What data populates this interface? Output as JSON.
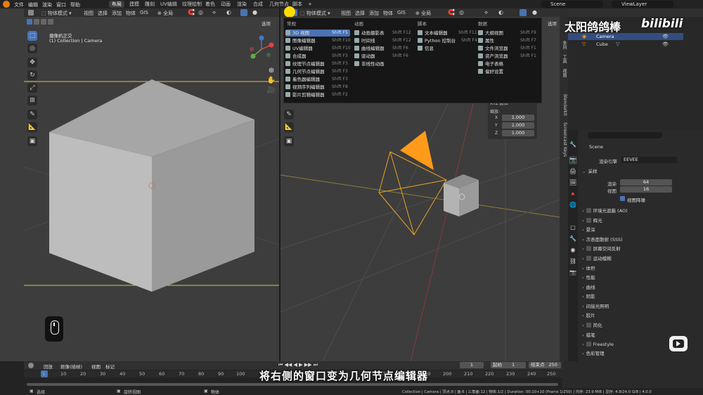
{
  "topbar": {
    "menus": [
      "文件",
      "编辑",
      "渲染",
      "窗口",
      "帮助"
    ],
    "workspace_tabs": [
      "布局",
      "建模",
      "雕刻",
      "UV编辑",
      "纹理绘制",
      "着色",
      "动画",
      "渲染",
      "合成",
      "几何节点",
      "脚本"
    ],
    "active_tab_index": 0,
    "add_tab": "+",
    "scene_name": "Scene",
    "view_layer": "ViewLayer"
  },
  "left_viewport": {
    "mode": "物体模式",
    "menus": [
      "视图",
      "选择",
      "添加",
      "物体",
      "GIS"
    ],
    "pivot": "全局",
    "options_label": "选项",
    "view_title": "摄像机正交",
    "view_subtitle": "(1) Collection | Camera"
  },
  "right_viewport": {
    "mode": "物体模式",
    "menus": [
      "视图",
      "选择",
      "添加",
      "物体",
      "GIS"
    ],
    "pivot": "全局",
    "options_label": "选项",
    "panel": {
      "title": "XYZ 欧拉",
      "scale_label": "缩放:",
      "rows": [
        {
          "axis": "X",
          "value": "1.000"
        },
        {
          "axis": "Y",
          "value": "1.000"
        },
        {
          "axis": "Z",
          "value": "1.000"
        }
      ]
    }
  },
  "editor_menu": {
    "columns": [
      {
        "title": "常规",
        "items": [
          {
            "label": "3D 视图",
            "shortcut": "Shift F5",
            "selected": true
          },
          {
            "label": "图像编辑器",
            "shortcut": "Shift F10"
          },
          {
            "label": "UV编辑器",
            "shortcut": "Shift F10"
          },
          {
            "label": "合成器",
            "shortcut": "Shift F3"
          },
          {
            "label": "纹理节点编辑器",
            "shortcut": "Shift F3"
          },
          {
            "label": "几何节点编辑器",
            "shortcut": "Shift F3"
          },
          {
            "label": "着色器编辑器",
            "shortcut": "Shift F3"
          },
          {
            "label": "视频序列编辑器",
            "shortcut": "Shift F8"
          },
          {
            "label": "影片剪辑编辑器",
            "shortcut": "Shift F2"
          }
        ]
      },
      {
        "title": "动画",
        "items": [
          {
            "label": "动画摄影表",
            "shortcut": "Shift F12"
          },
          {
            "label": "时间线",
            "shortcut": "Shift F12"
          },
          {
            "label": "曲线编辑器",
            "shortcut": "Shift F6"
          },
          {
            "label": "驱动器",
            "shortcut": "Shift F6"
          },
          {
            "label": "非线性动画",
            "shortcut": ""
          }
        ]
      },
      {
        "title": "脚本",
        "items": [
          {
            "label": "文本编辑器",
            "shortcut": "Shift F11"
          },
          {
            "label": "Python 控制台",
            "shortcut": "Shift F4"
          },
          {
            "label": "信息",
            "shortcut": ""
          }
        ]
      },
      {
        "title": "数据",
        "items": [
          {
            "label": "大纲视图",
            "shortcut": "Shift F9"
          },
          {
            "label": "属性",
            "shortcut": "Shift F7"
          },
          {
            "label": "文件浏览器",
            "shortcut": "Shift F1"
          },
          {
            "label": "资产浏览器",
            "shortcut": "Shift F1"
          },
          {
            "label": "电子表格",
            "shortcut": ""
          },
          {
            "label": "偏好设置",
            "shortcut": ""
          }
        ]
      }
    ]
  },
  "side_tabs": [
    "条目",
    "工具",
    "视图",
    "Blenderkit",
    "Screencast Keys"
  ],
  "outliner": {
    "items": [
      {
        "name": "Camera",
        "selected": true
      },
      {
        "name": "Cube",
        "selected": false
      }
    ]
  },
  "properties": {
    "scene_label": "Scene",
    "engine_label": "渲染引擎",
    "engine_value": "EEVEE",
    "sampling": {
      "title": "采样",
      "render_label": "渲染",
      "render_value": "64",
      "viewport_label": "视图",
      "viewport_value": "16",
      "denoise_label": "视图降噪"
    },
    "sections": [
      "环境光遮蔽 (AO)",
      "辉光",
      "景深",
      "次表面散射 (SSS)",
      "屏幕空间反射",
      "运动模糊",
      "体积",
      "性能",
      "曲线",
      "阴影",
      "间接光照明",
      "胶片",
      "简化",
      "蜡笔",
      "Freestyle",
      "色彩管理"
    ]
  },
  "timeline": {
    "menus": [
      "回放",
      "抠像(插帧)",
      "视图",
      "标记"
    ],
    "current_frame": "1",
    "start_label": "起始",
    "start_value": "1",
    "end_label": "结束点",
    "end_value": "250",
    "ticks": [
      "1",
      "10",
      "20",
      "30",
      "40",
      "50",
      "60",
      "70",
      "80",
      "90",
      "100",
      "170",
      "180",
      "190",
      "200",
      "210",
      "220",
      "230",
      "240",
      "250"
    ]
  },
  "status_bar": {
    "left": [
      "选择",
      "旋转视图",
      "物体"
    ],
    "right": "Collection | Camera | 顶点:8 | 面:6 | 三角面:12 | 物体:1/2 | Duration: 00:10+10 (Frame 1/250) | 内存: 23.9 MiB | 显存: 4.8/24.0 GiB | 4.0.0"
  },
  "subtitle": "将右侧的窗口变为几何节点编辑器",
  "watermark": {
    "channel": "太阳鸽鸽棒",
    "site": "bilibili"
  },
  "colors": {
    "accent_blue": "#4a72b4",
    "camera_orange": "#ff9a1a",
    "selection_yellow": "#ffdd00"
  }
}
